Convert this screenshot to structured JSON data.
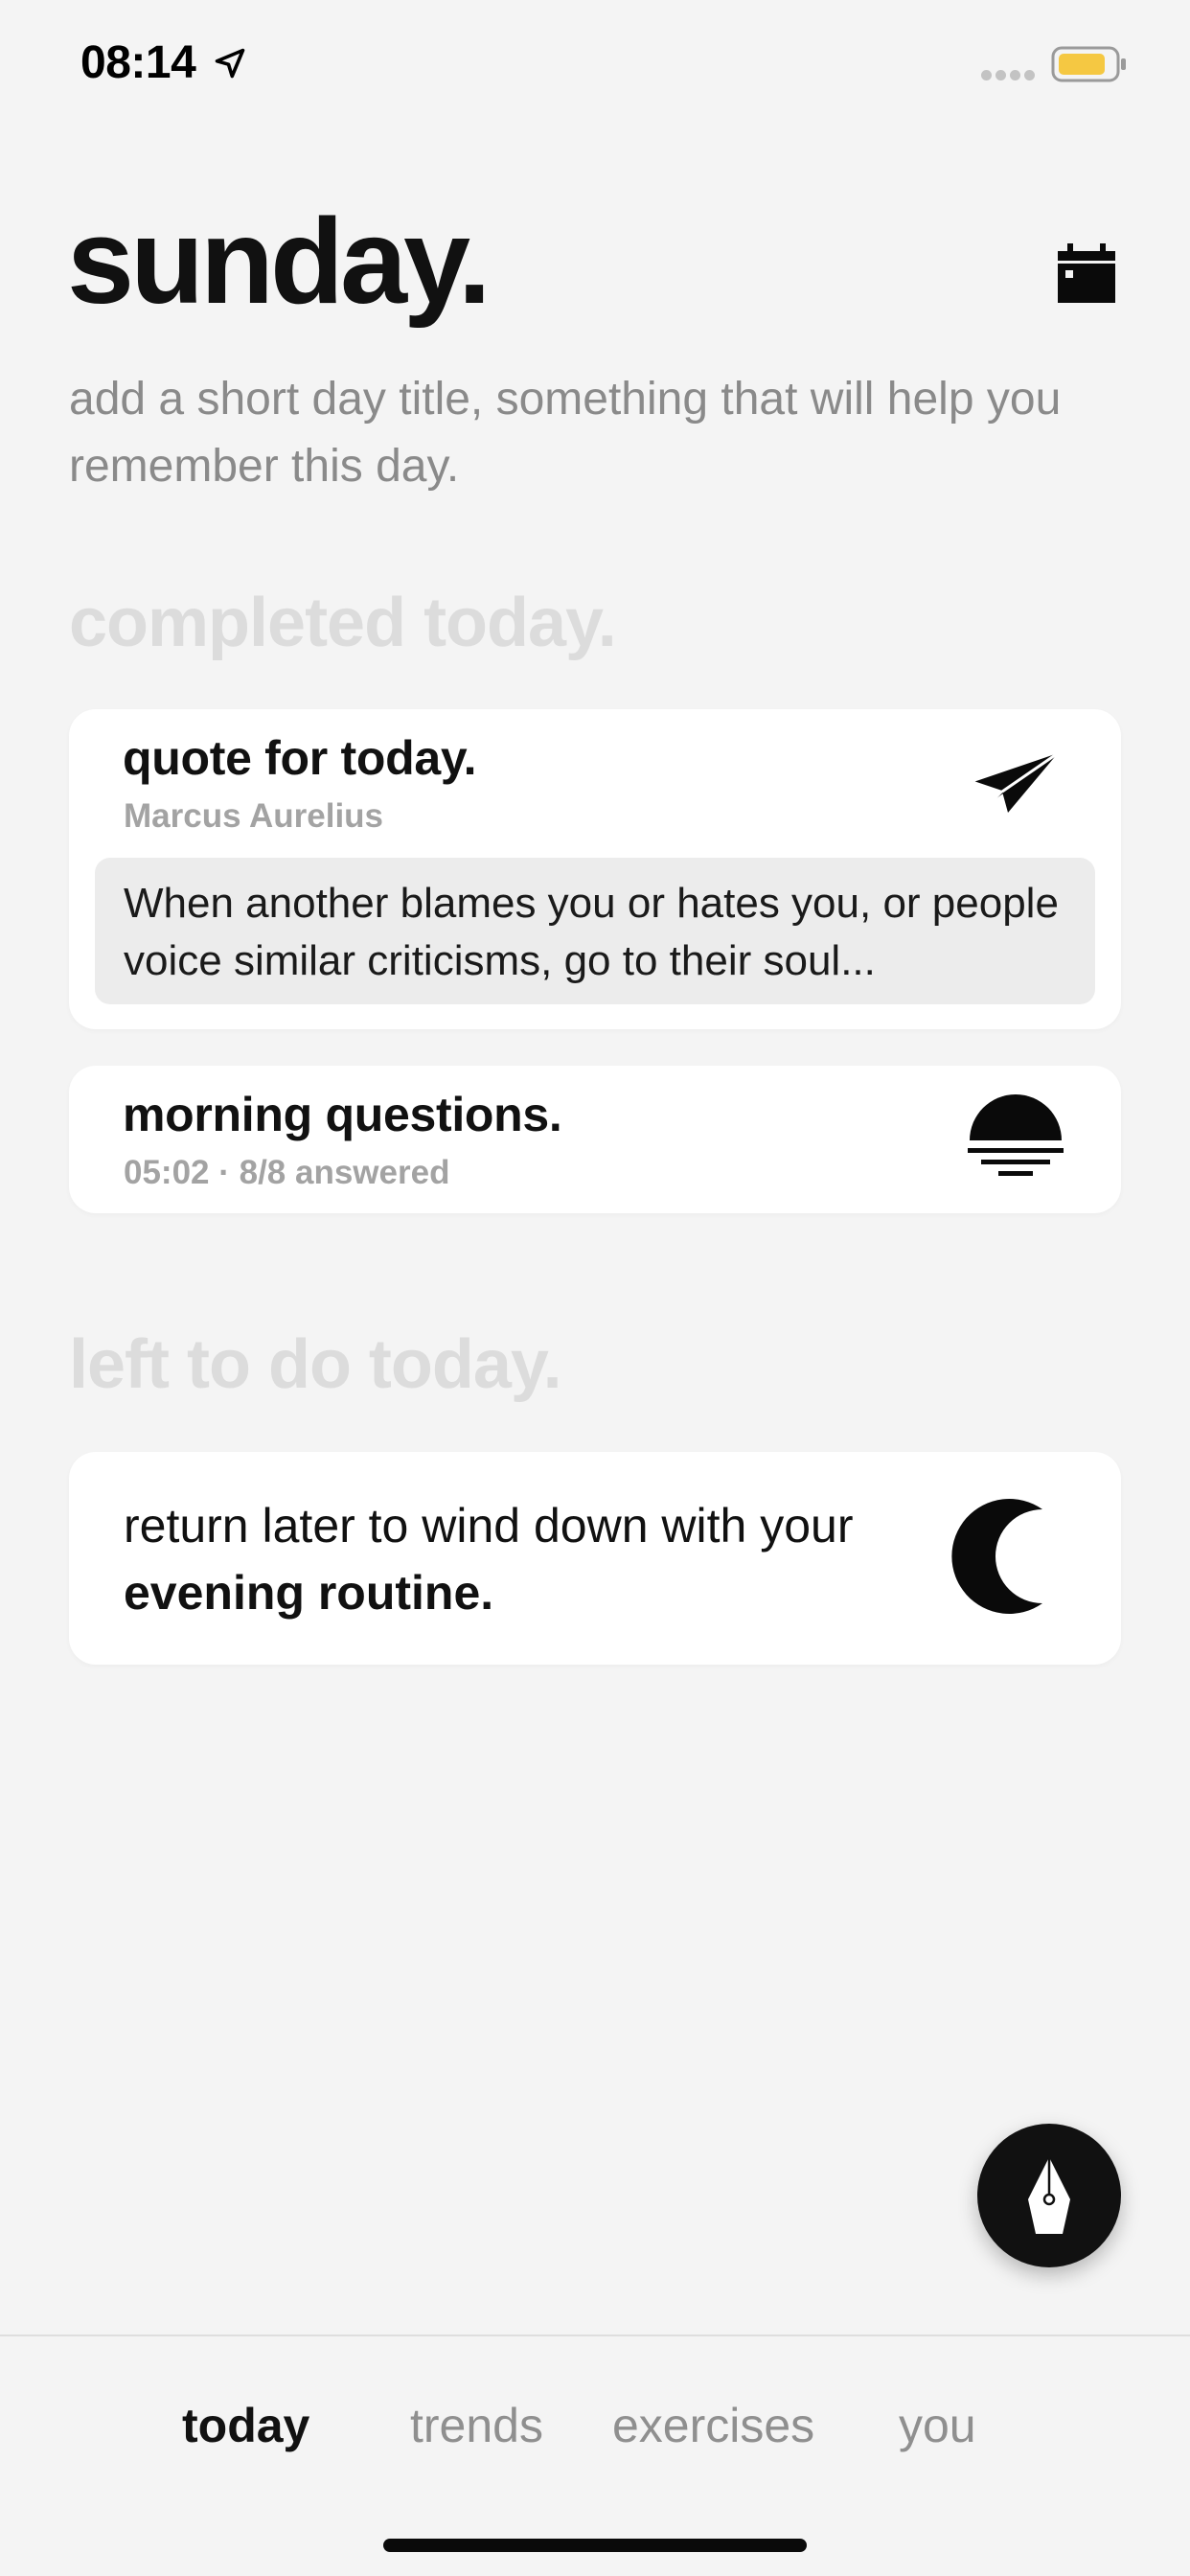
{
  "status_bar": {
    "time": "08:14",
    "location_icon": "location-arrow-icon",
    "battery_color": "#f5c842"
  },
  "header": {
    "title": "sunday.",
    "day_title_placeholder": "add a short day title, something that will help you remember this day.",
    "calendar_icon": "calendar-icon"
  },
  "completed": {
    "heading": "completed today.",
    "quote_card": {
      "title": "quote for today.",
      "author": "Marcus Aurelius",
      "quote": "When another blames you or hates you, or people voice similar criticisms, go to their soul...",
      "icon": "paper-plane-icon"
    },
    "morning_card": {
      "title": "morning questions.",
      "subtitle": "05:02 · 8/8 answered",
      "icon": "sunrise-icon"
    }
  },
  "left_to_do": {
    "heading": "left to do today.",
    "evening_card": {
      "text": "return later to wind down with your",
      "bold": "evening routine.",
      "icon": "moon-icon"
    }
  },
  "fab": {
    "icon": "fountain-pen-icon"
  },
  "tabs": [
    {
      "label": "today",
      "active": true
    },
    {
      "label": "trends",
      "active": false
    },
    {
      "label": "exercises",
      "active": false
    },
    {
      "label": "you",
      "active": false
    }
  ]
}
